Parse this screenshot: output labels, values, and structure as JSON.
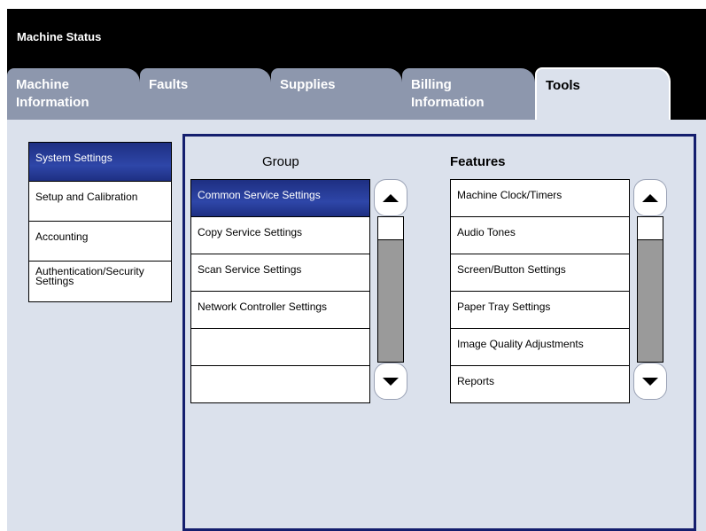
{
  "window": {
    "title": "Machine Status"
  },
  "tabs": [
    {
      "line1": "Machine",
      "line2": "Information"
    },
    {
      "line1": "Faults",
      "line2": ""
    },
    {
      "line1": "Supplies",
      "line2": ""
    },
    {
      "line1": "Billing",
      "line2": "Information"
    },
    {
      "line1": "Tools",
      "line2": ""
    }
  ],
  "active_tab": "Tools",
  "sidebar": {
    "items": [
      {
        "label": "System Settings"
      },
      {
        "label": "Setup and Calibration"
      },
      {
        "label": "Accounting"
      },
      {
        "label_line1": "Authentication/Security",
        "label_line2": "Settings"
      }
    ],
    "selected": "System Settings"
  },
  "group": {
    "heading": "Group",
    "items": [
      "Common Service Settings",
      "Copy Service Settings",
      "Scan Service Settings",
      "Network Controller Settings",
      "",
      ""
    ],
    "selected": "Common Service Settings"
  },
  "features": {
    "heading": "Features",
    "items": [
      "Machine Clock/Timers",
      "Audio Tones",
      "Screen/Button Settings",
      "Paper Tray Settings",
      "Image Quality Adjustments",
      "Reports"
    ]
  },
  "icons": {
    "scroll_up": "triangle-up-icon",
    "scroll_down": "triangle-down-icon"
  },
  "colors": {
    "selection": "#1e2f82",
    "panel_border": "#141e6e",
    "background": "#dbe1ec",
    "inactive_tab": "#8d97ad"
  }
}
